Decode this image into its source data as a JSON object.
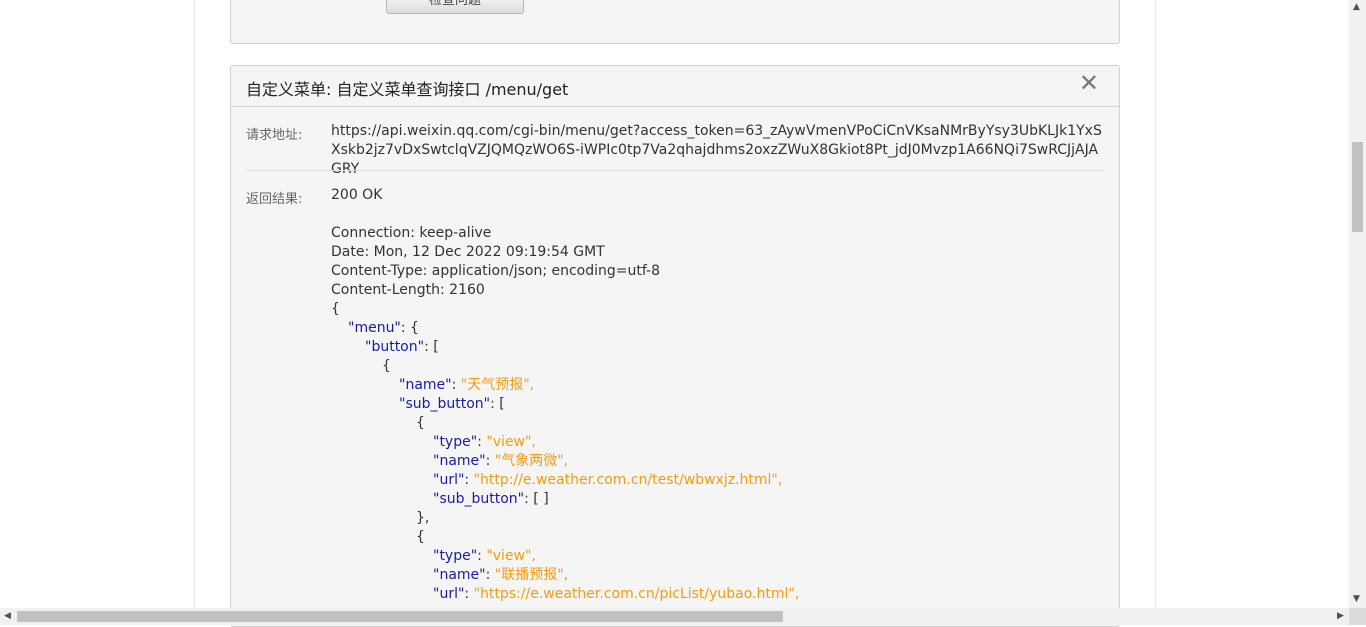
{
  "prev_panel": {
    "check_button_label": "检查问题"
  },
  "panel": {
    "title": "自定义菜单: 自定义菜单查询接口 /menu/get",
    "close_symbol": "✕",
    "request_label": "请求地址:",
    "request_url": "https://api.weixin.qq.com/cgi-bin/menu/get?access_token=63_zAywVmenVPoCiCnVKsaNMrByYsy3UbKLJk1YxSXskb2jz7vDxSwtclqVZJQMQzWO6S-iWPIc0tp7Va2qhajdhms2oxzZWuX8Gkiot8Pt_jdJ0Mvzp1A66NQi7SwRCJjAJAGRY",
    "result_label": "返回结果:",
    "status": "200 OK",
    "headers": [
      "Connection: keep-alive",
      "Date: Mon, 12 Dec 2022 09:19:54 GMT",
      "Content-Type: application/json; encoding=utf-8",
      "Content-Length: 2160"
    ],
    "json_lines": [
      {
        "indent": 0,
        "parts": [
          {
            "t": "p",
            "v": "{"
          }
        ]
      },
      {
        "indent": 1,
        "parts": [
          {
            "t": "k",
            "v": "\"menu\""
          },
          {
            "t": "p",
            "v": ": {"
          }
        ]
      },
      {
        "indent": 2,
        "parts": [
          {
            "t": "k",
            "v": "\"button\""
          },
          {
            "t": "p",
            "v": ": ["
          }
        ]
      },
      {
        "indent": 3,
        "parts": [
          {
            "t": "p",
            "v": "{"
          }
        ]
      },
      {
        "indent": 4,
        "parts": [
          {
            "t": "k",
            "v": "\"name\""
          },
          {
            "t": "p",
            "v": ": "
          },
          {
            "t": "s",
            "v": "\"天气预报\","
          }
        ]
      },
      {
        "indent": 4,
        "parts": [
          {
            "t": "k",
            "v": "\"sub_button\""
          },
          {
            "t": "p",
            "v": ": ["
          }
        ]
      },
      {
        "indent": 5,
        "parts": [
          {
            "t": "p",
            "v": "{"
          }
        ]
      },
      {
        "indent": 6,
        "parts": [
          {
            "t": "k",
            "v": "\"type\""
          },
          {
            "t": "p",
            "v": ": "
          },
          {
            "t": "s",
            "v": "\"view\","
          }
        ]
      },
      {
        "indent": 6,
        "parts": [
          {
            "t": "k",
            "v": "\"name\""
          },
          {
            "t": "p",
            "v": ": "
          },
          {
            "t": "s",
            "v": "\"气象两微\","
          }
        ]
      },
      {
        "indent": 6,
        "parts": [
          {
            "t": "k",
            "v": "\"url\""
          },
          {
            "t": "p",
            "v": ": "
          },
          {
            "t": "s",
            "v": "\"http://e.weather.com.cn/test/wbwxjz.html\","
          }
        ]
      },
      {
        "indent": 6,
        "parts": [
          {
            "t": "k",
            "v": "\"sub_button\""
          },
          {
            "t": "p",
            "v": ": [ ]"
          }
        ]
      },
      {
        "indent": 5,
        "parts": [
          {
            "t": "p",
            "v": "},"
          }
        ]
      },
      {
        "indent": 5,
        "parts": [
          {
            "t": "p",
            "v": "{"
          }
        ]
      },
      {
        "indent": 6,
        "parts": [
          {
            "t": "k",
            "v": "\"type\""
          },
          {
            "t": "p",
            "v": ": "
          },
          {
            "t": "s",
            "v": "\"view\","
          }
        ]
      },
      {
        "indent": 6,
        "parts": [
          {
            "t": "k",
            "v": "\"name\""
          },
          {
            "t": "p",
            "v": ": "
          },
          {
            "t": "s",
            "v": "\"联播预报\","
          }
        ]
      },
      {
        "indent": 6,
        "parts": [
          {
            "t": "k",
            "v": "\"url\""
          },
          {
            "t": "p",
            "v": ": "
          },
          {
            "t": "s",
            "v": "\"https://e.weather.com.cn/picList/yubao.html\","
          }
        ]
      }
    ]
  },
  "colors": {
    "key": "#1a1aa6",
    "string": "#f39c12"
  },
  "scrollbars": {
    "left_arrow": "◀",
    "right_arrow": "▶",
    "up_arrow": "▲",
    "down_arrow": "▼"
  }
}
